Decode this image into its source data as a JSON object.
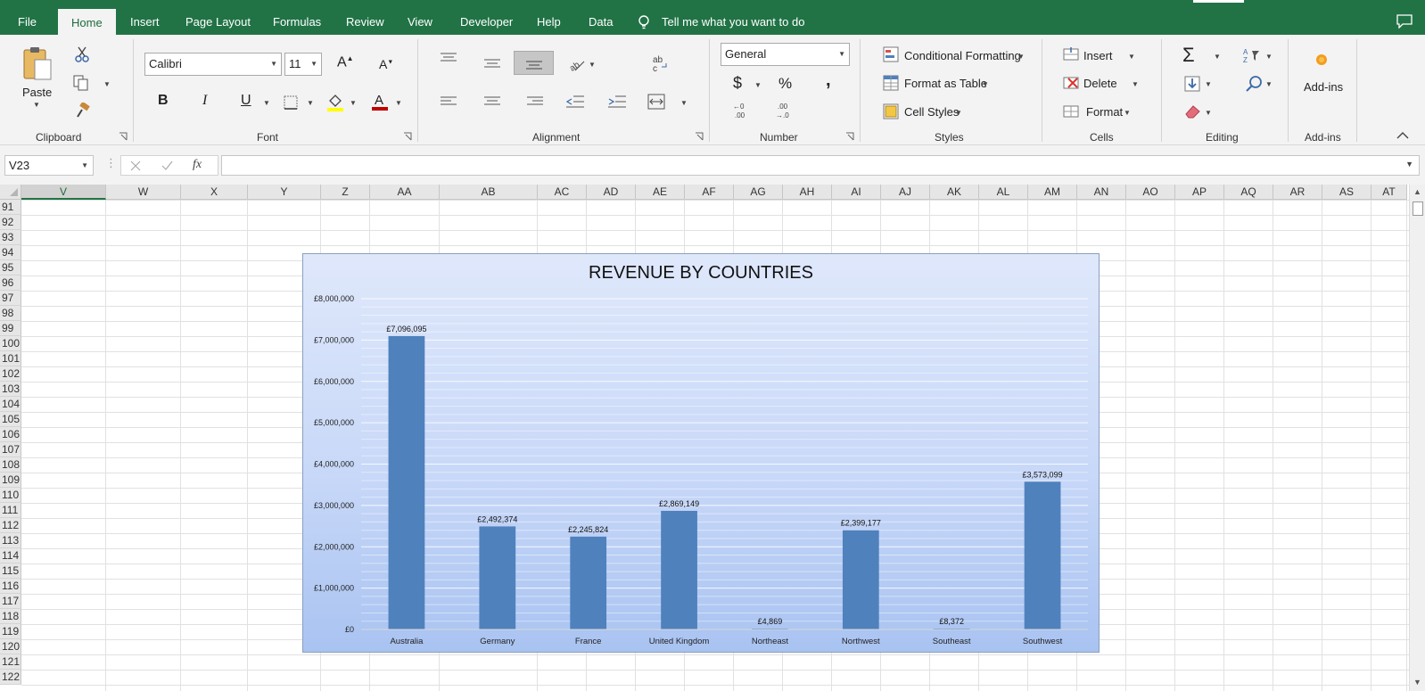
{
  "ribbon_tabs": [
    "File",
    "Home",
    "Insert",
    "Page Layout",
    "Formulas",
    "Review",
    "View",
    "Developer",
    "Help",
    "Data"
  ],
  "active_tab": "Home",
  "tell_me": "Tell me what you want to do",
  "clipboard": {
    "paste_label": "Paste",
    "group_label": "Clipboard"
  },
  "font": {
    "family": "Calibri",
    "size": "11",
    "group_label": "Font",
    "bold": "B",
    "italic": "I",
    "underline": "U"
  },
  "alignment": {
    "group_label": "Alignment"
  },
  "number": {
    "format": "General",
    "group_label": "Number",
    "currency": "$",
    "percent": "%",
    "comma": ","
  },
  "styles": {
    "conditional_formatting": "Conditional Formatting",
    "format_as_table": "Format as Table",
    "cell_styles": "Cell Styles",
    "group_label": "Styles"
  },
  "cells": {
    "insert": "Insert",
    "delete": "Delete",
    "format": "Format",
    "group_label": "Cells"
  },
  "editing": {
    "group_label": "Editing"
  },
  "addins": {
    "button_label": "Add-ins",
    "group_label": "Add-ins"
  },
  "formula_bar": {
    "name_box": "V23",
    "fx": "fx",
    "formula": ""
  },
  "columns": [
    "V",
    "W",
    "X",
    "Y",
    "Z",
    "AA",
    "AB",
    "AC",
    "AD",
    "AE",
    "AF",
    "AG",
    "AH",
    "AI",
    "AJ",
    "AK",
    "AL",
    "AM",
    "AN",
    "AO",
    "AP",
    "AQ",
    "AR",
    "AS",
    "AT"
  ],
  "selected_column": "V",
  "rows": [
    "91",
    "92",
    "93",
    "94",
    "95",
    "96",
    "97",
    "98",
    "99",
    "100",
    "101",
    "102",
    "103",
    "104",
    "105",
    "106",
    "107",
    "108",
    "109",
    "110",
    "111",
    "112",
    "113",
    "114",
    "115",
    "116",
    "117",
    "118",
    "119",
    "120",
    "121",
    "122"
  ],
  "colors": {
    "excel_green": "#217346",
    "bar": "#4f81bd"
  },
  "chart_data": {
    "type": "bar",
    "title": "REVENUE BY COUNTRIES",
    "categories": [
      "Australia",
      "Germany",
      "France",
      "United Kingdom",
      "Northeast",
      "Northwest",
      "Southeast",
      "Southwest"
    ],
    "values": [
      7096095,
      2492374,
      2245824,
      2869149,
      4869,
      2399177,
      8372,
      3573099
    ],
    "data_labels": [
      "£7,096,095",
      "£2,492,374",
      "£2,245,824",
      "£2,869,149",
      "£4,869",
      "£2,399,177",
      "£8,372",
      "£3,573,099"
    ],
    "y_ticks": [
      "£0",
      "£1,000,000",
      "£2,000,000",
      "£3,000,000",
      "£4,000,000",
      "£5,000,000",
      "£6,000,000",
      "£7,000,000",
      "£8,000,000"
    ],
    "ylim": [
      0,
      8000000
    ],
    "xlabel": "",
    "ylabel": "",
    "grid": true,
    "legend": "none"
  }
}
